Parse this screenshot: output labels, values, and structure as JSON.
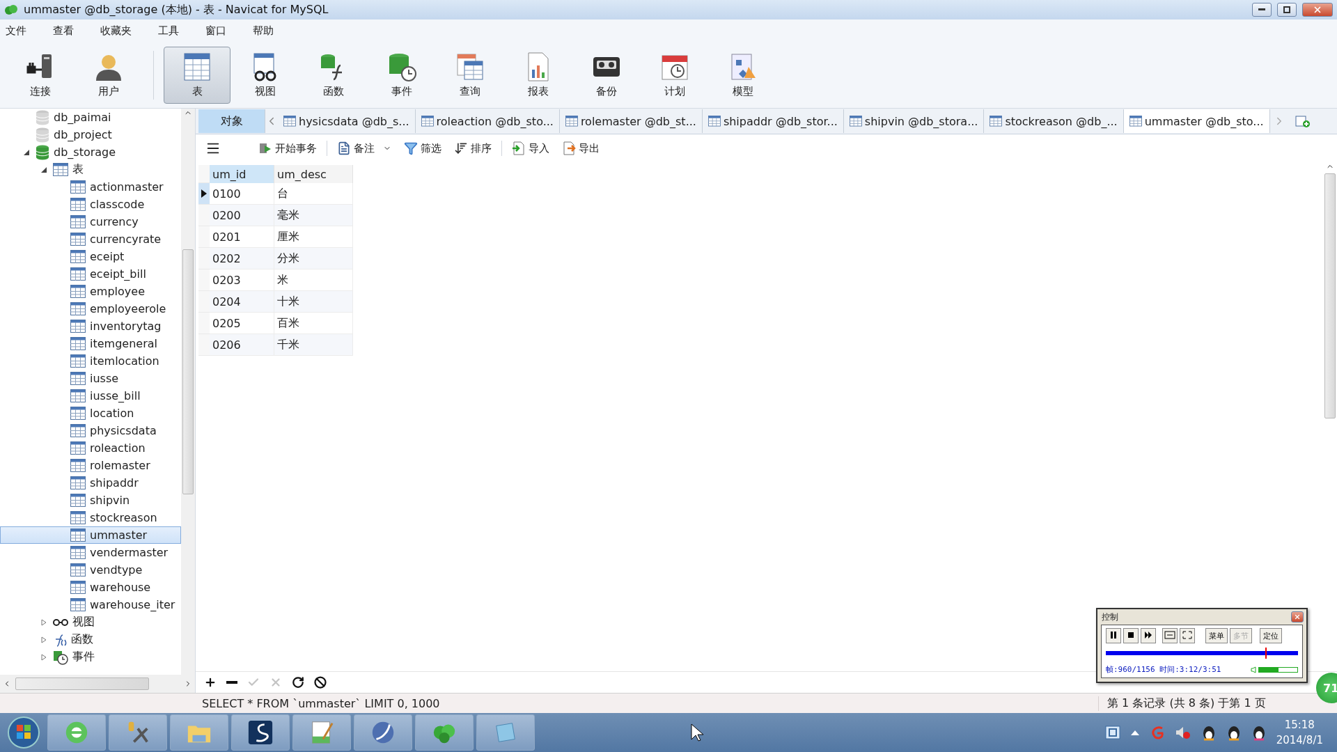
{
  "window": {
    "title": "ummaster @db_storage (本地) - 表 - Navicat for MySQL"
  },
  "menu": [
    "文件",
    "查看",
    "收藏夹",
    "工具",
    "窗口",
    "帮助"
  ],
  "toolbar": [
    {
      "label": "连接",
      "selected": false
    },
    {
      "label": "用户",
      "selected": false
    },
    {
      "label": "表",
      "selected": true
    },
    {
      "label": "视图",
      "selected": false
    },
    {
      "label": "函数",
      "selected": false
    },
    {
      "label": "事件",
      "selected": false
    },
    {
      "label": "查询",
      "selected": false
    },
    {
      "label": "报表",
      "selected": false
    },
    {
      "label": "备份",
      "selected": false
    },
    {
      "label": "计划",
      "selected": false
    },
    {
      "label": "模型",
      "selected": false
    }
  ],
  "tree": [
    {
      "label": "db_paimai",
      "kind": "database",
      "opened": false,
      "selected": false
    },
    {
      "label": "db_project",
      "kind": "database",
      "opened": false,
      "selected": false
    },
    {
      "label": "db_storage",
      "kind": "database",
      "opened": true,
      "expanded": true,
      "selected": false,
      "children": [
        {
          "label": "表",
          "kind": "tables",
          "expanded": true,
          "selected": false,
          "children": [
            {
              "label": "actionmaster",
              "kind": "table",
              "selected": false
            },
            {
              "label": "classcode",
              "kind": "table",
              "selected": false
            },
            {
              "label": "currency",
              "kind": "table",
              "selected": false
            },
            {
              "label": "currencyrate",
              "kind": "table",
              "selected": false
            },
            {
              "label": "eceipt",
              "kind": "table",
              "selected": false
            },
            {
              "label": "eceipt_bill",
              "kind": "table",
              "selected": false
            },
            {
              "label": "employee",
              "kind": "table",
              "selected": false
            },
            {
              "label": "employeerole",
              "kind": "table",
              "selected": false
            },
            {
              "label": "inventorytag",
              "kind": "table",
              "selected": false
            },
            {
              "label": "itemgeneral",
              "kind": "table",
              "selected": false
            },
            {
              "label": "itemlocation",
              "kind": "table",
              "selected": false
            },
            {
              "label": "iusse",
              "kind": "table",
              "selected": false
            },
            {
              "label": "iusse_bill",
              "kind": "table",
              "selected": false
            },
            {
              "label": "location",
              "kind": "table",
              "selected": false
            },
            {
              "label": "physicsdata",
              "kind": "table",
              "selected": false
            },
            {
              "label": "roleaction",
              "kind": "table",
              "selected": false
            },
            {
              "label": "rolemaster",
              "kind": "table",
              "selected": false
            },
            {
              "label": "shipaddr",
              "kind": "table",
              "selected": false
            },
            {
              "label": "shipvin",
              "kind": "table",
              "selected": false
            },
            {
              "label": "stockreason",
              "kind": "table",
              "selected": false
            },
            {
              "label": "ummaster",
              "kind": "table",
              "selected": true
            },
            {
              "label": "vendermaster",
              "kind": "table",
              "selected": false
            },
            {
              "label": "vendtype",
              "kind": "table",
              "selected": false
            },
            {
              "label": "warehouse",
              "kind": "table",
              "selected": false
            },
            {
              "label": "warehouse_iter",
              "kind": "table",
              "selected": false
            }
          ]
        },
        {
          "label": "视图",
          "kind": "views",
          "expanded": false,
          "selected": false
        },
        {
          "label": "函数",
          "kind": "functions",
          "expanded": false,
          "selected": false
        },
        {
          "label": "事件",
          "kind": "events",
          "expanded": false,
          "selected": false
        }
      ]
    }
  ],
  "tabs": [
    {
      "label": "对象",
      "kind": "objects",
      "selected": false
    },
    {
      "label": "hysicsdata @db_s...",
      "kind": "table",
      "selected": false
    },
    {
      "label": "roleaction @db_sto...",
      "kind": "table",
      "selected": false
    },
    {
      "label": "rolemaster @db_st...",
      "kind": "table",
      "selected": false
    },
    {
      "label": "shipaddr @db_stor...",
      "kind": "table",
      "selected": false
    },
    {
      "label": "shipvin @db_stora...",
      "kind": "table",
      "selected": false
    },
    {
      "label": "stockreason @db_...",
      "kind": "table",
      "selected": false
    },
    {
      "label": "ummaster @db_sto...",
      "kind": "table",
      "selected": true
    }
  ],
  "table_toolbar": [
    {
      "label": "开始事务",
      "dropdown": false
    },
    {
      "label": "备注",
      "dropdown": true
    },
    {
      "label": "筛选",
      "dropdown": false
    },
    {
      "label": "排序",
      "dropdown": false
    },
    {
      "label": "导入",
      "dropdown": false
    },
    {
      "label": "导出",
      "dropdown": false
    }
  ],
  "table": {
    "columns": [
      {
        "label": "um_id",
        "selected": true
      },
      {
        "label": "um_desc",
        "selected": false
      }
    ],
    "rows": [
      {
        "cells": [
          "0100",
          "台"
        ],
        "selected": true
      },
      {
        "cells": [
          "0200",
          "毫米"
        ],
        "selected": false
      },
      {
        "cells": [
          "0201",
          "厘米"
        ],
        "selected": false
      },
      {
        "cells": [
          "0202",
          "分米"
        ],
        "selected": false
      },
      {
        "cells": [
          "0203",
          "米"
        ],
        "selected": false
      },
      {
        "cells": [
          "0204",
          "十米"
        ],
        "selected": false
      },
      {
        "cells": [
          "0205",
          "百米"
        ],
        "selected": false
      },
      {
        "cells": [
          "0206",
          "千米"
        ],
        "selected": false
      }
    ]
  },
  "grid_actions": [
    {
      "disabled": false
    },
    {
      "disabled": false
    },
    {
      "disabled": true
    },
    {
      "disabled": true
    },
    {
      "disabled": false
    },
    {
      "disabled": false
    }
  ],
  "status_bar": {
    "query": "SELECT * FROM `ummaster` LIMIT 0, 1000",
    "records": "第 1 条记录 (共 8 条) 于第 1 页"
  },
  "taskbar": {
    "time": "15:18",
    "date": "2014/8/1"
  },
  "control_panel": {
    "title": "控制",
    "buttons": [
      {
        "label": "菜单",
        "disabled": false
      },
      {
        "label": "多节",
        "disabled": true
      },
      {
        "label": "定位",
        "disabled": false
      }
    ],
    "progress": {
      "level": 0.83
    },
    "status": "帧:960/1156 时间:3:12/3:51",
    "volume": {
      "level": 0.5
    }
  },
  "badge": {
    "label": "71"
  }
}
